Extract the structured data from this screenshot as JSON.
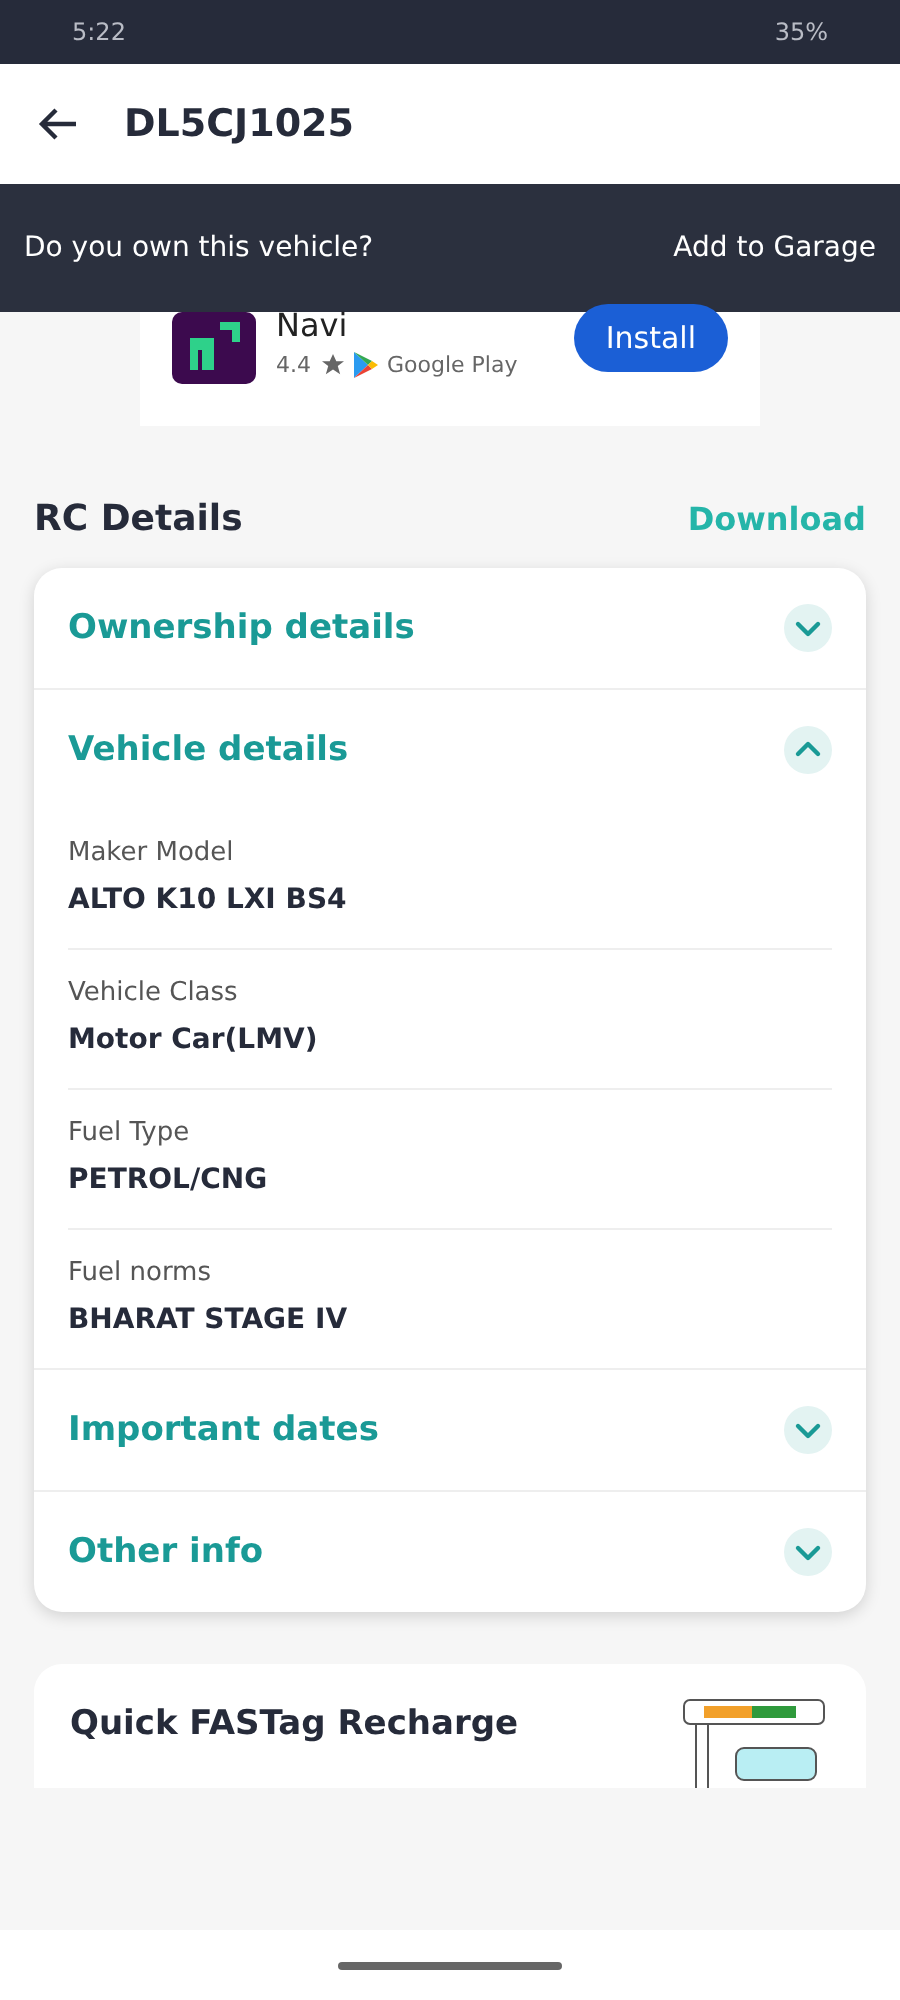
{
  "status_bar": {
    "time": "5:22",
    "battery": "35%"
  },
  "app_bar": {
    "title": "DL5CJ1025"
  },
  "banner": {
    "question": "Do you own this vehicle?",
    "action": "Add to Garage"
  },
  "ad": {
    "app_name": "Navi",
    "rating": "4.4",
    "store": "Google Play",
    "button": "Install"
  },
  "rc": {
    "title": "RC Details",
    "action": "Download",
    "sections": [
      {
        "title": "Ownership details",
        "expanded": false
      },
      {
        "title": "Vehicle details",
        "expanded": true,
        "fields": [
          {
            "label": "Maker Model",
            "value": "ALTO K10 LXI BS4"
          },
          {
            "label": "Vehicle Class",
            "value": "Motor Car(LMV)"
          },
          {
            "label": "Fuel Type",
            "value": "PETROL/CNG"
          },
          {
            "label": "Fuel norms",
            "value": "BHARAT STAGE IV"
          }
        ]
      },
      {
        "title": "Important dates",
        "expanded": false
      },
      {
        "title": "Other info",
        "expanded": false
      }
    ]
  },
  "promo": {
    "title": "Quick FASTag Recharge"
  }
}
